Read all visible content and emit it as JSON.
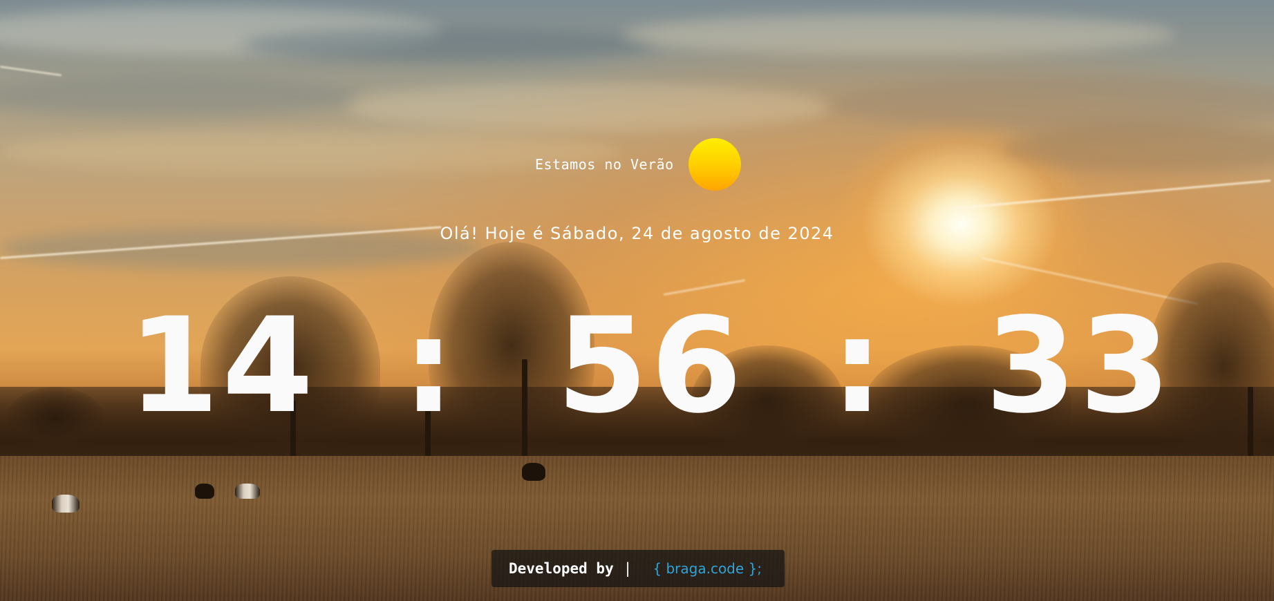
{
  "season": {
    "text": "Estamos no Verão",
    "icon": "sun-icon",
    "icon_color_top": "#ffee00",
    "icon_color_bottom": "#ffa400"
  },
  "greeting": "Olá! Hoje é Sábado, 24 de agosto de 2024",
  "clock": {
    "hours": "14",
    "minutes": "56",
    "seconds": "33",
    "separator": ":"
  },
  "footer": {
    "developed_by": "Developed by",
    "pipe": "|",
    "brand_open": "{",
    "brand_name": "braga.code",
    "brand_close": "}",
    "brand_semicolon": ";",
    "brand_color": "#2fa4d8"
  }
}
